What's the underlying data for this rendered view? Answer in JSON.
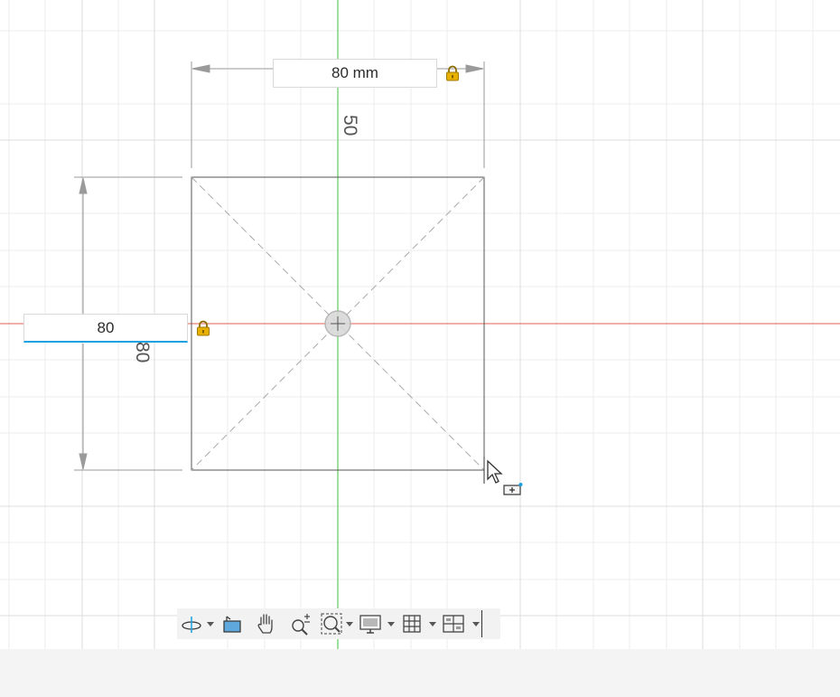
{
  "sketch": {
    "width_dimension": "80 mm",
    "height_dimension_input": "80",
    "top_dimension_label": "50",
    "left_dimension_label": "80"
  },
  "colors": {
    "x_axis": "#e06055",
    "y_axis": "#7fd67f",
    "input_focus": "#1ba1e2",
    "lock": "#e8b100"
  },
  "toolbar": {
    "icons": [
      "orbit-icon",
      "look-at-icon",
      "pan-icon",
      "zoom-icon",
      "fit-icon",
      "display-settings-icon",
      "grid-settings-icon",
      "viewports-icon"
    ]
  }
}
